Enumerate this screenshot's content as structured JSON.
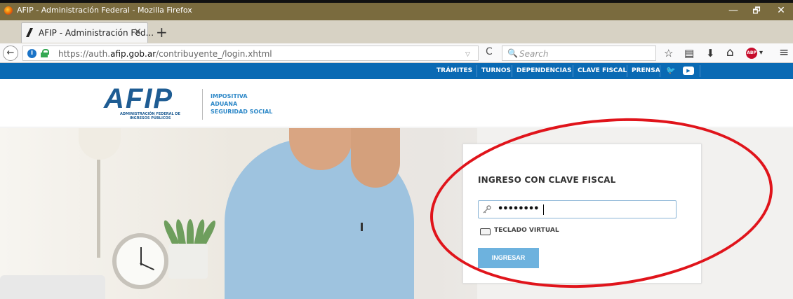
{
  "window": {
    "title": "AFIP - Administración Federal - Mozilla Firefox",
    "minimize": "—",
    "restore": "🗗",
    "close": "✕"
  },
  "tabs": [
    {
      "title": "AFIP - Administración Fed...",
      "close": "✕"
    }
  ],
  "new_tab": "+",
  "navbar": {
    "back": "←",
    "info": "i",
    "url_prefix": "https://auth.",
    "url_domain": "afip.gob.ar",
    "url_suffix": "/contribuyente_/login.xhtml",
    "dropdown": "▽",
    "reload": "C",
    "search_icon": "🔍",
    "search_placeholder": "Search",
    "bookmark": "☆",
    "library": "▤",
    "download": "⬇",
    "home": "⌂",
    "abp": "ABP",
    "abp_menu": "▾",
    "menu": "≡"
  },
  "afip_nav": {
    "items": [
      "TRÁMITES",
      "TURNOS",
      "DEPENDENCIAS",
      "CLAVE FISCAL",
      "PRENSA"
    ],
    "twitter": "🐦",
    "youtube": "▶"
  },
  "header": {
    "logo_text": "AFIP",
    "logo_subtitle_1": "ADMINISTRACIÓN FEDERAL DE",
    "logo_subtitle_2": "INGRESOS PÚBLICOS",
    "tagline": [
      "IMPOSITIVA",
      "ADUANA",
      "SEGURIDAD SOCIAL"
    ]
  },
  "login": {
    "title": "INGRESO CON CLAVE FISCAL",
    "password_value": "••••••••",
    "virtual_keyboard": "TECLADO VIRTUAL",
    "submit": "INGRESAR"
  },
  "colors": {
    "afip_blue": "#0a6ab4",
    "button": "#6db2de",
    "annotation": "#e0141b"
  }
}
